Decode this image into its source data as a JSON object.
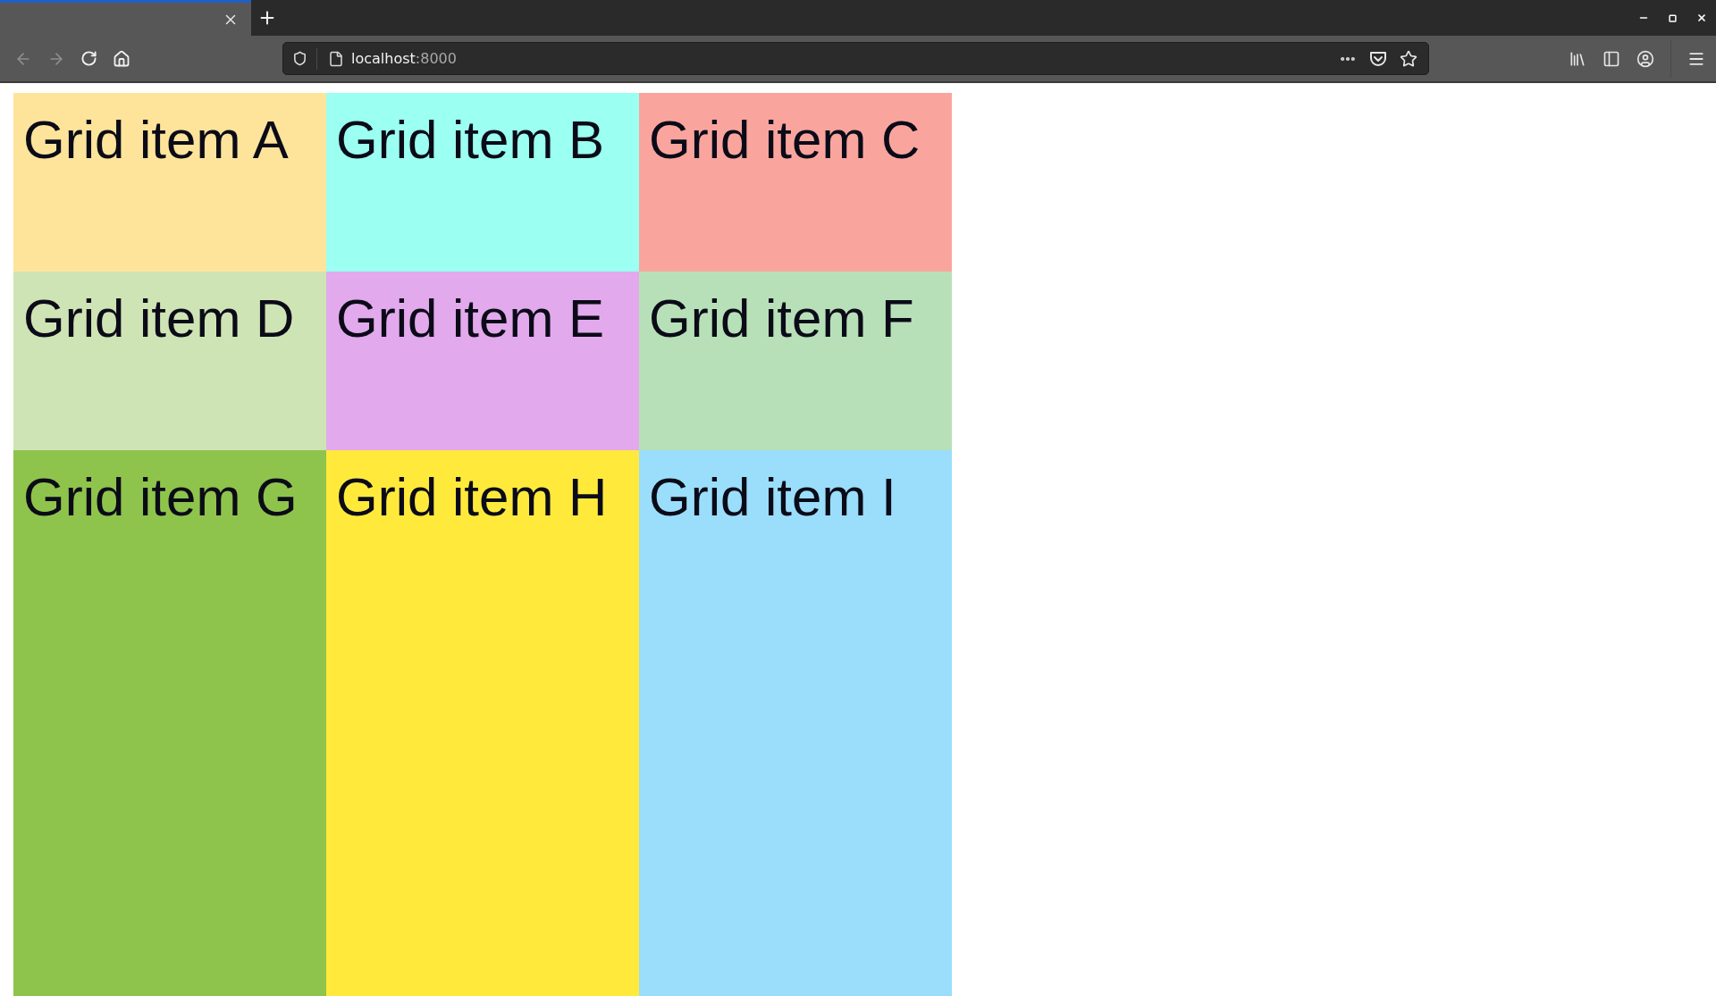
{
  "toolbar": {
    "back": {
      "disabled": true
    },
    "forward": {
      "disabled": true
    },
    "address": {
      "host": "localhost",
      "port": ":8000"
    }
  },
  "grid": {
    "items": [
      {
        "label": "Grid item A",
        "color": "#fee49a"
      },
      {
        "label": "Grid item B",
        "color": "#9bfff1"
      },
      {
        "label": "Grid item C",
        "color": "#f9a59e"
      },
      {
        "label": "Grid item D",
        "color": "#cfe4b4"
      },
      {
        "label": "Grid item E",
        "color": "#e2a9ec"
      },
      {
        "label": "Grid item F",
        "color": "#b8e0b8"
      },
      {
        "label": "Grid item G",
        "color": "#8ec44b"
      },
      {
        "label": "Grid item H",
        "color": "#ffea3c"
      },
      {
        "label": "Grid item I",
        "color": "#9adefb"
      }
    ]
  }
}
